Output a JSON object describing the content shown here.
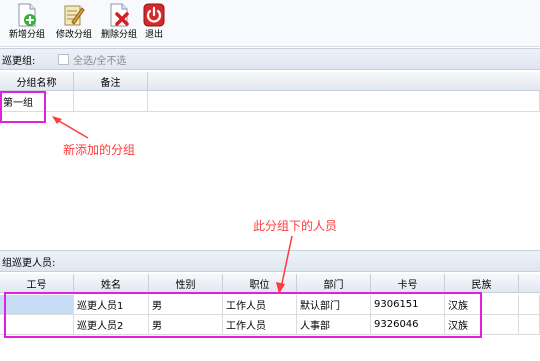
{
  "toolbar": {
    "items": [
      {
        "label": "新增分组",
        "icon": "add-group-icon"
      },
      {
        "label": "修改分组",
        "icon": "edit-group-icon"
      },
      {
        "label": "删除分组",
        "icon": "delete-group-icon"
      },
      {
        "label": "退出",
        "icon": "power-icon"
      }
    ]
  },
  "patrol_group": {
    "title": "巡更组:",
    "select_all_label": "全选/全不选",
    "columns": [
      "分组名称",
      "备注"
    ],
    "rows": [
      {
        "name": "第一组",
        "note": ""
      }
    ]
  },
  "members": {
    "title": "组巡更人员:",
    "columns": [
      "工号",
      "姓名",
      "性别",
      "职位",
      "部门",
      "卡号",
      "民族"
    ],
    "rows": [
      {
        "id": "",
        "name": "巡更人员1",
        "gender": "男",
        "position": "工作人员",
        "dept": "默认部门",
        "card": "9306151",
        "ethnic": "汉族"
      },
      {
        "id": "",
        "name": "巡更人员2",
        "gender": "男",
        "position": "工作人员",
        "dept": "人事部",
        "card": "9326046",
        "ethnic": "汉族"
      }
    ]
  },
  "annotations": {
    "new_group": "新添加的分组",
    "members_under": "此分组下的人员"
  },
  "colors": {
    "annotation_box": "#e020e0",
    "annotation_text": "#ff3b3b",
    "selection": "#c7dcf5"
  }
}
